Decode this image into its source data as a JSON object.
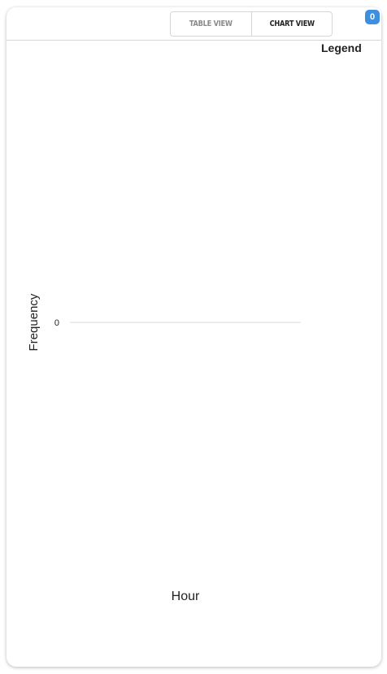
{
  "toolbar": {
    "table_view_label": "TABLE VIEW",
    "chart_view_label": "CHART VIEW",
    "active_view": "chart"
  },
  "badge": {
    "count": "0",
    "color": "#3d8fe0"
  },
  "legend": {
    "title": "Legend"
  },
  "chart_data": {
    "type": "bar",
    "xlabel": "Hour",
    "ylabel": "Frequency",
    "categories": [],
    "series": [],
    "y_ticks": [
      0
    ],
    "ylim": [
      0,
      0
    ],
    "grid": true,
    "legend_position": "top-right",
    "gridline_color": "#d9d9d9"
  }
}
